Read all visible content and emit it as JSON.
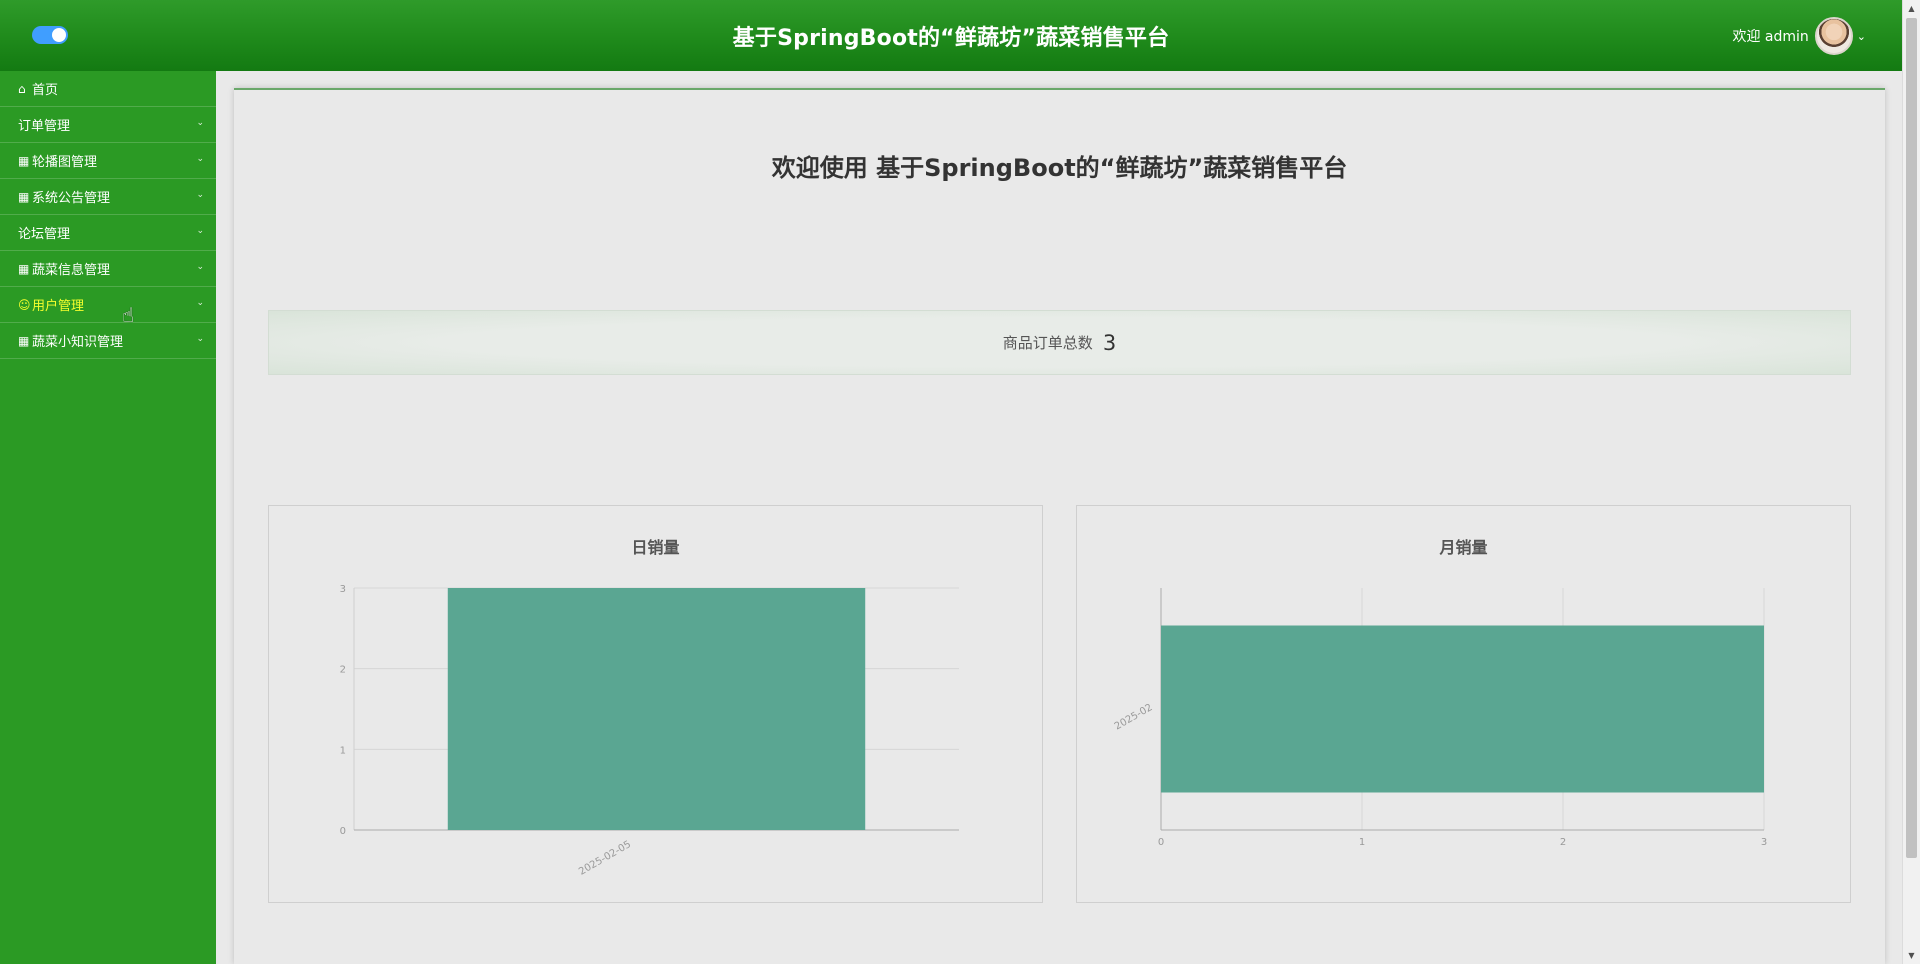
{
  "header": {
    "title": "基于SpringBoot的“鲜蔬坊”蔬菜销售平台",
    "welcome": "欢迎 admin"
  },
  "sidebar": {
    "items": [
      {
        "label": "首页",
        "icon": "home-icon",
        "has_children": false
      },
      {
        "label": "订单管理",
        "icon": "",
        "has_children": true
      },
      {
        "label": "轮播图管理",
        "icon": "grid-icon",
        "has_children": true
      },
      {
        "label": "系统公告管理",
        "icon": "grid-icon",
        "has_children": true
      },
      {
        "label": "论坛管理",
        "icon": "",
        "has_children": true
      },
      {
        "label": "蔬菜信息管理",
        "icon": "grid-icon",
        "has_children": true
      },
      {
        "label": "用户管理",
        "icon": "user-icon",
        "has_children": true,
        "active": true
      },
      {
        "label": "蔬菜小知识管理",
        "icon": "grid-icon",
        "has_children": true
      }
    ]
  },
  "main": {
    "welcome_title": "欢迎使用 基于SpringBoot的“鲜蔬坊”蔬菜销售平台",
    "stat": {
      "label": "商品订单总数",
      "value": "3"
    }
  },
  "colors": {
    "header": "#1f8a1b",
    "sidebar": "#2b9a24",
    "active_menu_text": "#f5ff2d",
    "bar": "#5aa692",
    "toggle": "#409eff"
  },
  "chart_data": [
    {
      "type": "bar",
      "title": "日销量",
      "orientation": "vertical",
      "categories": [
        "2025-02-05"
      ],
      "values": [
        3
      ],
      "ylim": [
        0,
        3
      ],
      "yticks": [
        "0",
        "1",
        "2",
        "3"
      ],
      "grid": true,
      "color": "#5aa692"
    },
    {
      "type": "bar",
      "title": "月销量",
      "orientation": "horizontal",
      "categories": [
        "2025-02"
      ],
      "values": [
        3
      ],
      "xlim": [
        0,
        3
      ],
      "xticks": [
        "0",
        "1",
        "2",
        "3"
      ],
      "grid": true,
      "color": "#5aa692"
    }
  ]
}
